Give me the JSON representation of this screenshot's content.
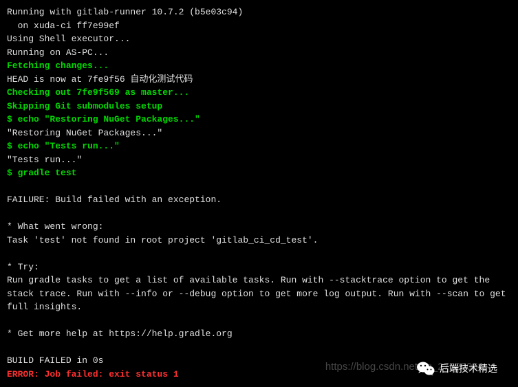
{
  "terminal": {
    "lines": [
      {
        "text": "Running with gitlab-runner 10.7.2 (b5e03c94)",
        "color": "white"
      },
      {
        "text": "  on xuda-ci ff7e99ef",
        "color": "white"
      },
      {
        "text": "Using Shell executor...",
        "color": "white"
      },
      {
        "text": "Running on AS-PC...",
        "color": "white"
      },
      {
        "text": "Fetching changes...",
        "color": "green"
      },
      {
        "text": "HEAD is now at 7fe9f56 自动化测试代码",
        "color": "white"
      },
      {
        "text": "Checking out 7fe9f569 as master...",
        "color": "green"
      },
      {
        "text": "Skipping Git submodules setup",
        "color": "green"
      },
      {
        "text": "$ echo \"Restoring NuGet Packages...\"",
        "color": "green"
      },
      {
        "text": "\"Restoring NuGet Packages...\"",
        "color": "white"
      },
      {
        "text": "$ echo \"Tests run...\"",
        "color": "green"
      },
      {
        "text": "\"Tests run...\"",
        "color": "white"
      },
      {
        "text": "$ gradle test",
        "color": "green"
      },
      {
        "text": "",
        "color": "white"
      },
      {
        "text": "FAILURE: Build failed with an exception.",
        "color": "white"
      },
      {
        "text": "",
        "color": "white"
      },
      {
        "text": "* What went wrong:",
        "color": "white"
      },
      {
        "text": "Task 'test' not found in root project 'gitlab_ci_cd_test'.",
        "color": "white"
      },
      {
        "text": "",
        "color": "white"
      },
      {
        "text": "* Try:",
        "color": "white"
      },
      {
        "text": "Run gradle tasks to get a list of available tasks. Run with --stacktrace option to get the stack trace. Run with --info or --debug option to get more log output. Run with --scan to get full insights.",
        "color": "white"
      },
      {
        "text": "",
        "color": "white"
      },
      {
        "text": "* Get more help at https://help.gradle.org",
        "color": "white"
      },
      {
        "text": "",
        "color": "white"
      },
      {
        "text": "BUILD FAILED in 0s",
        "color": "white"
      },
      {
        "text": "ERROR: Job failed: exit status 1",
        "color": "red"
      }
    ]
  },
  "watermark": {
    "url": "https://blog.csdn.net/qq_27520064",
    "badge_text": "后端技术精选"
  }
}
